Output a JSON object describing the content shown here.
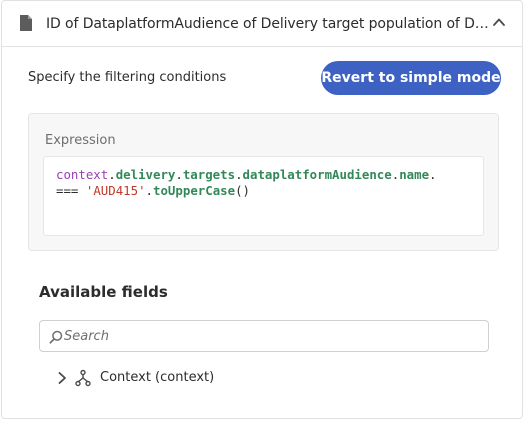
{
  "header": {
    "title": "ID of DataplatformAudience of Delivery target population of Delivery of Context",
    "doc_icon": "document-icon",
    "collapse_icon": "chevron-up-icon"
  },
  "filter": {
    "subtitle": "Specify the filtering conditions",
    "revert_label": "Revert to simple mode"
  },
  "expression": {
    "label": "Expression",
    "line1": {
      "t1": "context",
      "t2": ".",
      "t3": "delivery",
      "t4": ".",
      "t5": "targets",
      "t6": ".",
      "t7": "dataplatformAudience",
      "t8": ".",
      "t9": "name",
      "t10": "."
    },
    "line2": {
      "t1": "===",
      "t2": " ",
      "t3": "'AUD415'",
      "t4": ".",
      "t5": "toUpperCase",
      "t6": "()"
    }
  },
  "fields": {
    "title": "Available fields",
    "search_placeholder": "Search",
    "tree": [
      {
        "label": "Context (context)",
        "icon": "schema-tree-icon",
        "expand_icon": "chevron-right-icon"
      }
    ]
  },
  "colors": {
    "accent": "#3d62c3",
    "code_context": "#9c3fb4",
    "code_property": "#33885a",
    "code_string": "#c0392b"
  }
}
